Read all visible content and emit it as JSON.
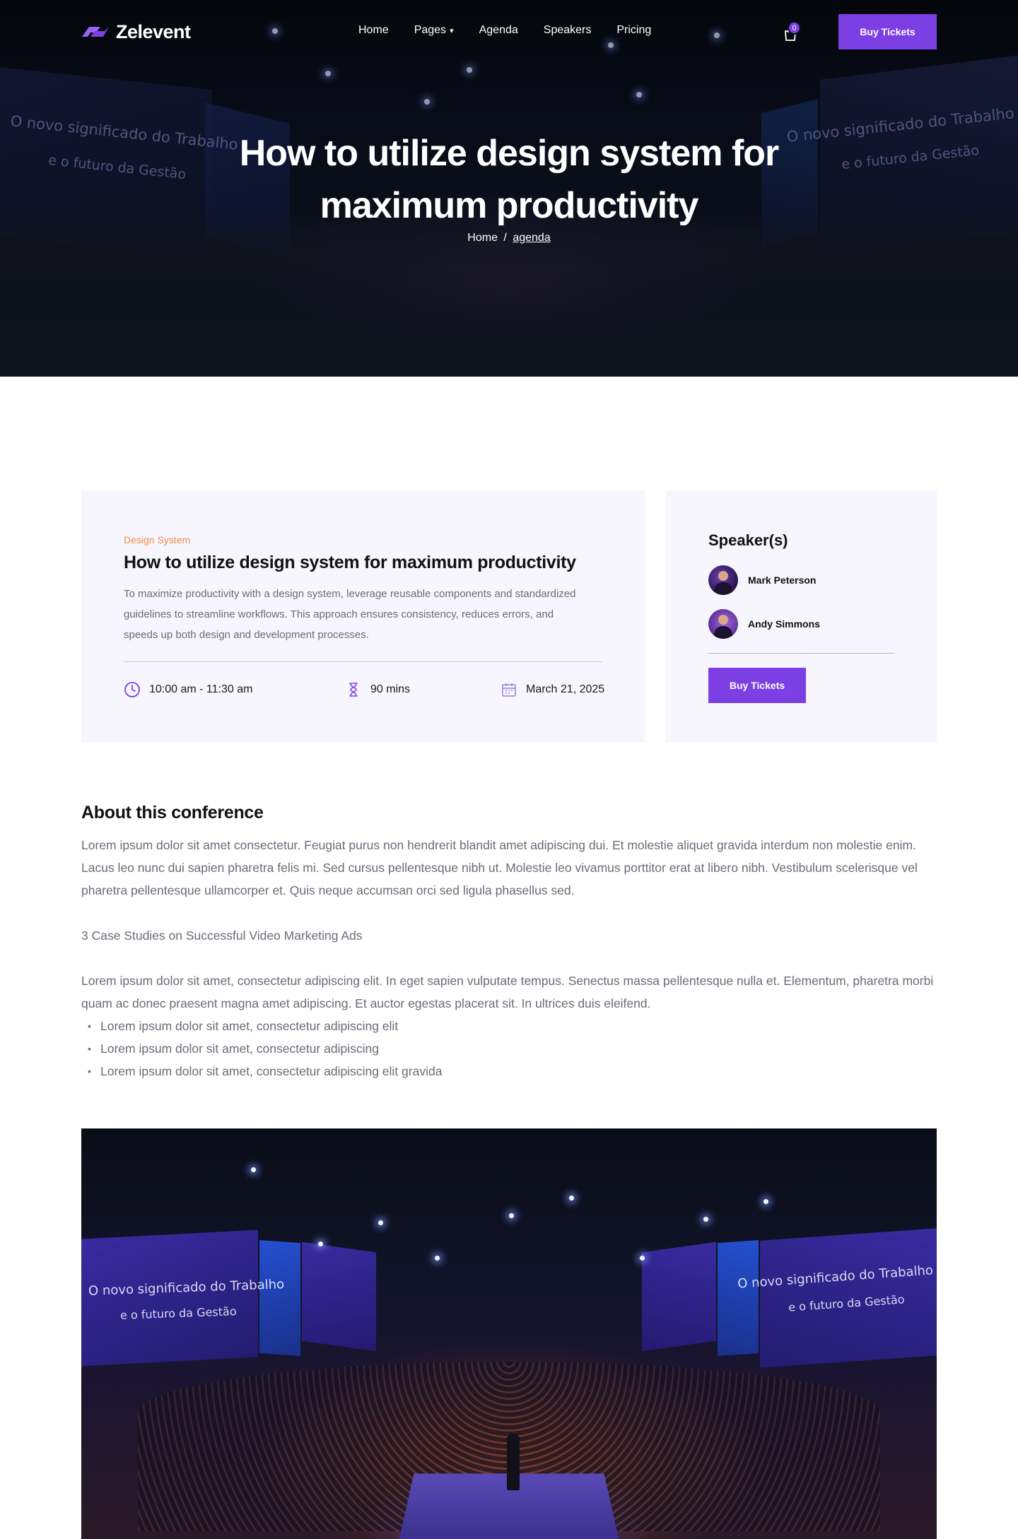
{
  "brand": {
    "name": "Zelevent",
    "accent": "#7b3fe4"
  },
  "nav": {
    "items": [
      {
        "label": "Home"
      },
      {
        "label": "Pages"
      },
      {
        "label": "Agenda"
      },
      {
        "label": "Speakers"
      },
      {
        "label": "Pricing"
      }
    ],
    "cart_count": "0",
    "cta_label": "Buy Tickets"
  },
  "hero": {
    "title_line1": "How to utilize design system for",
    "title_line2": "maximum productivity",
    "breadcrumb": {
      "home": "Home",
      "separator": "/",
      "current": "agenda"
    },
    "screen_text_line1": "O novo significado do Trabalho",
    "screen_text_line2": "e o futuro da Gestão"
  },
  "session": {
    "tag": "Design System",
    "title": "How to utilize design system for maximum productivity",
    "description": "To maximize productivity with a design system, leverage reusable components and standardized guidelines to streamline workflows. This approach ensures consistency, reduces errors, and speeds up both design and development processes.",
    "time": "10:00 am - 11:30 am",
    "duration": "90 mins",
    "date": "March 21, 2025",
    "icons": {
      "time": "clock-icon",
      "duration": "hourglass-icon",
      "date": "calendar-icon"
    },
    "tag_color": "#f58a4b"
  },
  "speakers": {
    "title": "Speaker(s)",
    "list": [
      {
        "name": "Mark Peterson"
      },
      {
        "name": "Andy Simmons"
      }
    ],
    "cta_label": "Buy Tickets"
  },
  "about": {
    "title": "About this conference",
    "paragraph1": "Lorem ipsum dolor sit amet consectetur. Feugiat purus non hendrerit blandit amet adipiscing dui. Et molestie aliquet gravida interdum non molestie enim. Lacus leo nunc dui sapien pharetra felis mi. Sed cursus pellentesque nibh ut. Molestie leo vivamus porttitor erat at libero nibh. Vestibulum scelerisque vel pharetra pellentesque ullamcorper et. Quis neque accumsan orci sed ligula phasellus sed.",
    "subheading": "3 Case Studies on Successful Video Marketing Ads",
    "paragraph2": "Lorem ipsum dolor sit amet, consectetur adipiscing elit. In eget sapien vulputate tempus. Senectus massa pellentesque nulla et. Elementum, pharetra morbi quam ac donec praesent magna amet adipiscing. Et auctor egestas placerat sit. In ultrices duis eleifend.",
    "bullets": [
      "Lorem ipsum dolor sit amet, consectetur adipiscing elit",
      "Lorem ipsum dolor sit amet, consectetur adipiscing",
      "Lorem ipsum dolor sit amet, consectetur adipiscing elit gravida"
    ]
  },
  "venue_image": {
    "screen_text_line1": "O novo significado do Trabalho",
    "screen_text_line2": "e o futuro da Gestão"
  }
}
